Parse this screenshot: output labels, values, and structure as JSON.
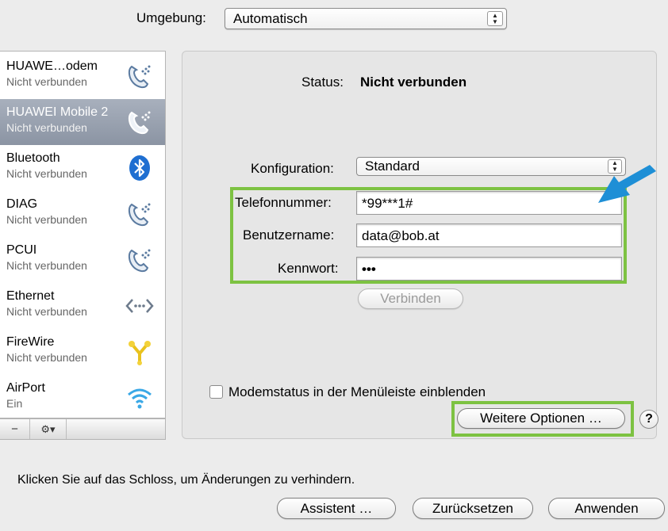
{
  "location": {
    "label": "Umgebung:",
    "value": "Automatisch"
  },
  "services": [
    {
      "name": "HUAWE…odem",
      "status": "Nicht verbunden",
      "icon": "phone-modem-icon",
      "selected": false
    },
    {
      "name": "HUAWEI Mobile 2",
      "status": "Nicht verbunden",
      "icon": "phone-modem-icon",
      "selected": true
    },
    {
      "name": "Bluetooth",
      "status": "Nicht verbunden",
      "icon": "bluetooth-icon",
      "selected": false
    },
    {
      "name": "DIAG",
      "status": "Nicht verbunden",
      "icon": "phone-modem-icon",
      "selected": false
    },
    {
      "name": "PCUI",
      "status": "Nicht verbunden",
      "icon": "phone-modem-icon",
      "selected": false
    },
    {
      "name": "Ethernet",
      "status": "Nicht verbunden",
      "icon": "ethernet-icon",
      "selected": false
    },
    {
      "name": "FireWire",
      "status": "Nicht verbunden",
      "icon": "firewire-icon",
      "selected": false
    },
    {
      "name": "AirPort",
      "status": "Ein",
      "icon": "airport-wifi-icon",
      "selected": false
    }
  ],
  "sidebar_footer": {
    "remove": "−",
    "gear": "⚙▾"
  },
  "panel": {
    "status_label": "Status:",
    "status_value": "Nicht verbunden",
    "config_label": "Konfiguration:",
    "config_value": "Standard",
    "phone_label": "Telefonnummer:",
    "phone_value": "*99***1#",
    "user_label": "Benutzername:",
    "user_value": "data@bob.at",
    "pass_label": "Kennwort:",
    "pass_value": "•••",
    "connect_button": "Verbinden",
    "modem_checkbox_label": "Modemstatus in der Menüleiste einblenden",
    "modem_checkbox_checked": false,
    "more_options_button": "Weitere Optionen …",
    "help_button": "?"
  },
  "bottom": {
    "lock_text": "Klicken Sie auf das Schloss, um Änderungen zu verhindern.",
    "assistant_button": "Assistent …",
    "revert_button": "Zurücksetzen",
    "apply_button": "Anwenden"
  },
  "colors": {
    "highlight_box": "#7dc242",
    "arrow": "#1e8fd6",
    "selection": "#8b94a3"
  }
}
